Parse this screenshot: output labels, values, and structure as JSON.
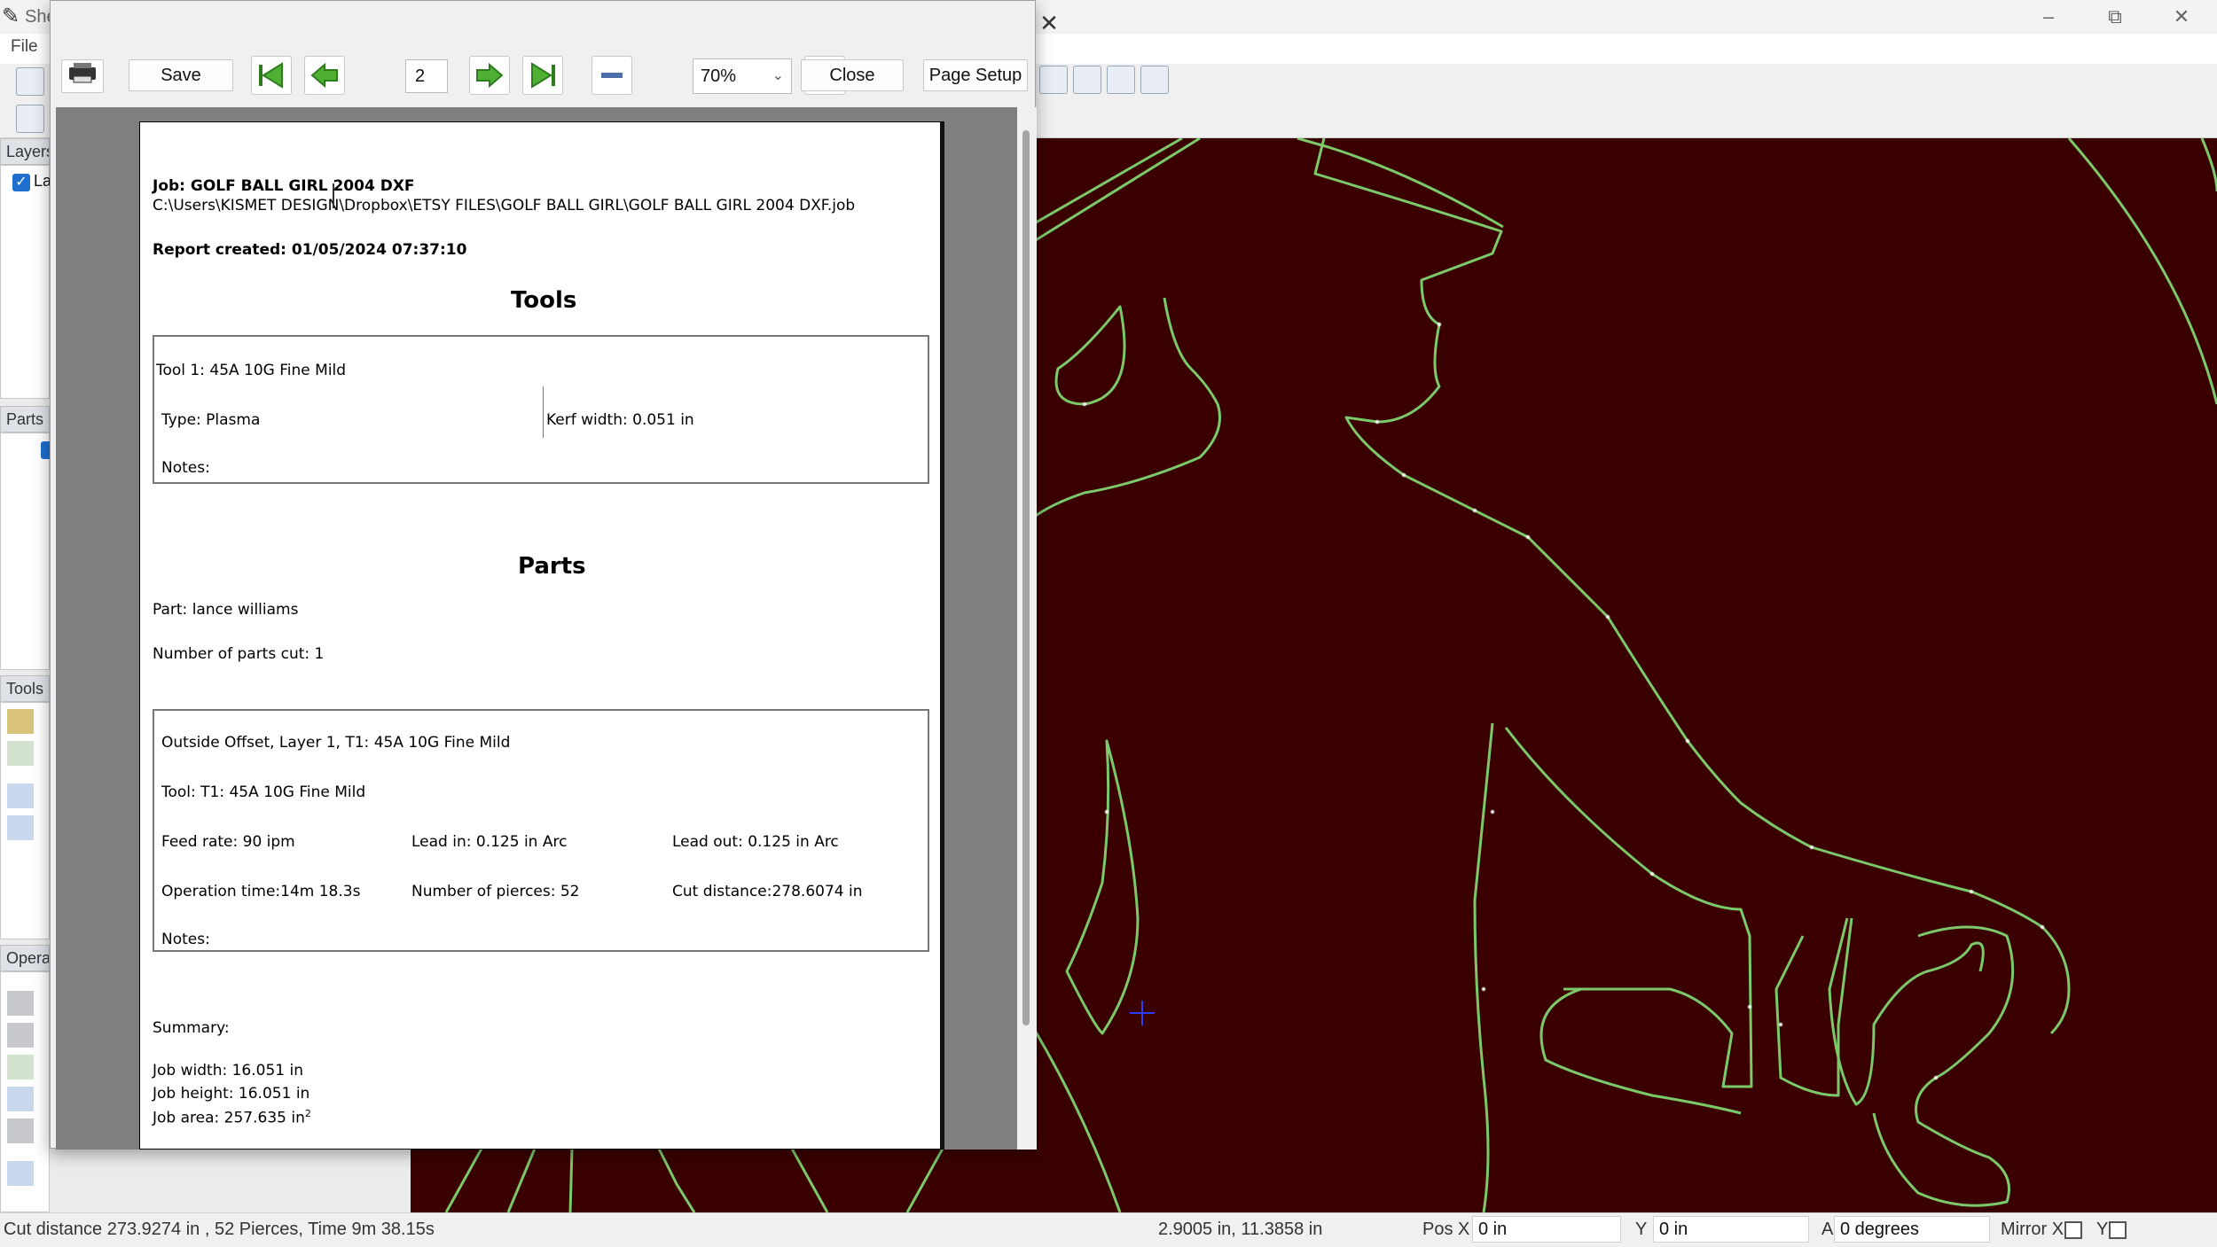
{
  "app": {
    "title": "She",
    "menu": {
      "file": "File"
    },
    "window_controls": {
      "minimize": "–",
      "restore": "⧉",
      "close": "✕"
    }
  },
  "left_dock": {
    "layers_title": "Layers",
    "layer_item": "La",
    "parts_title": "Parts",
    "tools_title": "Tools",
    "operations_title": "Opera"
  },
  "preview": {
    "close_x": "✕",
    "save_label": "Save",
    "page_number": "2",
    "zoom_value": "70%",
    "close_label": "Close",
    "page_setup_label": "Page Setup",
    "icons": {
      "print": "printer-icon",
      "first": "first-page-icon",
      "prev": "previous-page-icon",
      "next": "next-page-icon",
      "last": "last-page-icon",
      "zoom_out": "zoom-out-icon",
      "zoom_in": "zoom-in-icon"
    }
  },
  "report": {
    "job_line": "Job: GOLF BALL GIRL 2004 DXF",
    "job_path": "C:\\Users\\KISMET DESIGN\\Dropbox\\ETSY FILES\\GOLF BALL GIRL\\GOLF BALL GIRL 2004 DXF.job",
    "created": "Report created: 01/05/2024 07:37:10",
    "tools_heading": "Tools",
    "tool_name": "Tool 1: 45A 10G Fine Mild",
    "tool_type": "Type: Plasma",
    "kerf": "Kerf width: 0.051 in",
    "tool_notes": "Notes:",
    "parts_heading": "Parts",
    "part_name": "Part: lance williams",
    "parts_cut": "Number of parts cut: 1",
    "op_title": "Outside Offset, Layer 1, T1: 45A 10G Fine Mild",
    "op_tool": "Tool: T1: 45A 10G Fine Mild",
    "feed_rate": "Feed rate: 90 ipm",
    "lead_in": "Lead in: 0.125 in Arc",
    "lead_out": "Lead out: 0.125 in Arc",
    "op_time": "Operation time:14m 18.3s",
    "pierces": "Number of pierces: 52",
    "cut_distance": "Cut distance:278.6074 in",
    "op_notes": "Notes:",
    "summary": "Summary:",
    "job_width": "Job width: 16.051 in",
    "job_height": "Job height: 16.051 in",
    "job_area": "Job area: 257.635 in",
    "area_unit_sup": "2"
  },
  "status": {
    "cut_summary": "Cut distance 273.9274 in , 52 Pierces, Time 9m 38.15s",
    "coords": "2.9005 in, 11.3858 in",
    "pos_x_label": "Pos X",
    "pos_x_value": "0 in",
    "y_label": "Y",
    "y_value": "0 in",
    "a_label": "A",
    "a_value": "0 degrees",
    "mirror_x_label": "Mirror X",
    "mirror_y_label": "Y"
  },
  "colors": {
    "canvas_bg": "#3a0000",
    "cut_path": "#7cc96a",
    "cut_nodes": "#ffffff",
    "dialog_bg": "#f0f0f0"
  }
}
